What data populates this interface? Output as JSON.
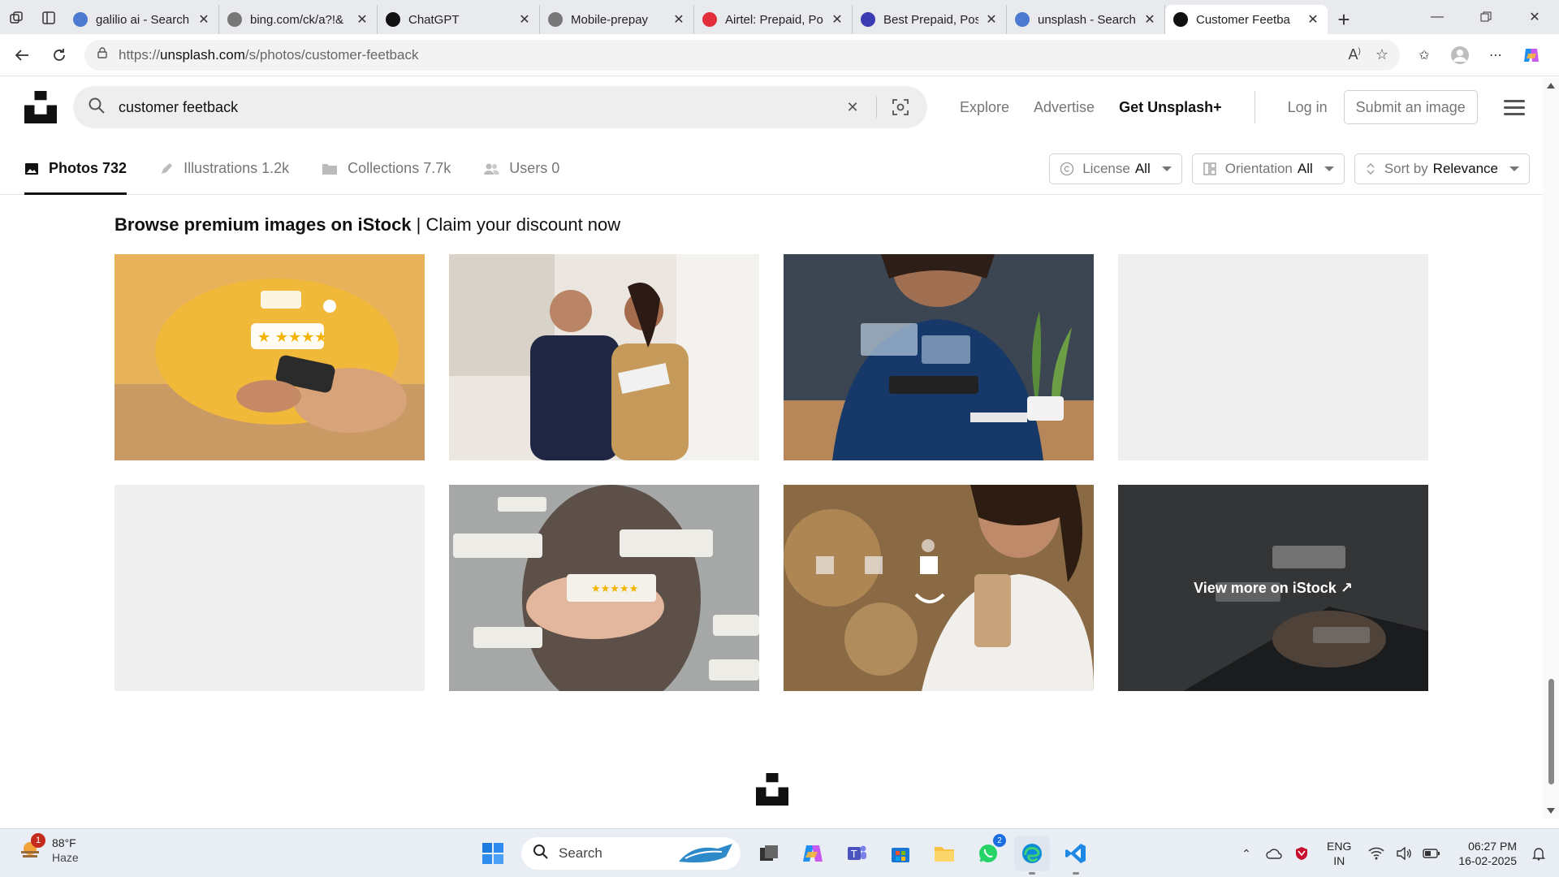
{
  "browser": {
    "tabs": [
      {
        "title": "galilio ai - Search",
        "favicon": "search-icon",
        "color": "#4a7bd0"
      },
      {
        "title": "bing.com/ck/a?!&",
        "favicon": "loading-icon",
        "color": "#777777"
      },
      {
        "title": "ChatGPT",
        "favicon": "chatgpt-icon",
        "color": "#111111"
      },
      {
        "title": "Mobile-prepay",
        "favicon": "globe-icon",
        "color": "#777777"
      },
      {
        "title": "Airtel: Prepaid, Po",
        "favicon": "airtel-icon",
        "color": "#e42f3a"
      },
      {
        "title": "Best Prepaid, Post",
        "favicon": "jio-icon",
        "color": "#3b3bb3"
      },
      {
        "title": "unsplash - Search",
        "favicon": "search-icon",
        "color": "#4a7bd0"
      },
      {
        "title": "Customer Feetba",
        "favicon": "unsplash-icon",
        "color": "#111111",
        "active": true
      }
    ],
    "url_prefix": "https://",
    "url_host": "unsplash.com",
    "url_path": "/s/photos/customer-feetback"
  },
  "header": {
    "search_query": "customer feetback",
    "nav": {
      "explore": "Explore",
      "advertise": "Advertise",
      "unsplash_plus": "Get Unsplash+"
    },
    "login": "Log in",
    "submit": "Submit an image"
  },
  "filters": {
    "tabs": [
      {
        "label": "Photos",
        "count": "732",
        "icon": "photo-icon",
        "active": true
      },
      {
        "label": "Illustrations",
        "count": "1.2k",
        "icon": "pen-icon"
      },
      {
        "label": "Collections",
        "count": "7.7k",
        "icon": "folder-icon"
      },
      {
        "label": "Users",
        "count": "0",
        "icon": "users-icon"
      }
    ],
    "license": {
      "label": "License",
      "value": "All"
    },
    "orientation": {
      "label": "Orientation",
      "value": "All"
    },
    "sort": {
      "label": "Sort by",
      "value": "Relevance"
    }
  },
  "istock": {
    "bold": "Browse premium images on iStock",
    "rest": "| Claim your discount now",
    "view_more": "View more on iStock ↗"
  },
  "tiles": [
    {
      "name": "tile-phone-review",
      "kind": "img"
    },
    {
      "name": "tile-business-people",
      "kind": "img"
    },
    {
      "name": "tile-tablet-review",
      "kind": "img"
    },
    {
      "name": "tile-empty-1",
      "kind": "empty"
    },
    {
      "name": "tile-empty-2",
      "kind": "empty"
    },
    {
      "name": "tile-hands-stars",
      "kind": "img"
    },
    {
      "name": "tile-woman-phone",
      "kind": "img"
    },
    {
      "name": "tile-laptop-view-more",
      "kind": "img"
    }
  ],
  "taskbar": {
    "temp": "88°F",
    "condition": "Haze",
    "weather_badge": "1",
    "search": "Search",
    "whatsapp_badge": "2",
    "lang1": "ENG",
    "lang2": "IN",
    "time": "06:27 PM",
    "date": "16-02-2025"
  }
}
